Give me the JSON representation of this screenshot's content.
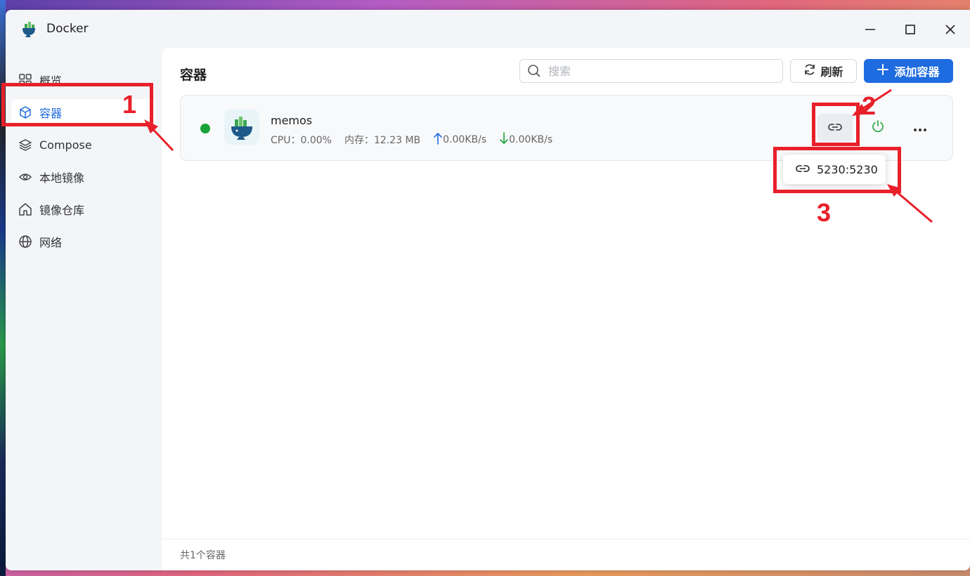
{
  "window": {
    "title": "Docker"
  },
  "sidebar": {
    "items": [
      {
        "label": "概览",
        "icon": "grid-icon"
      },
      {
        "label": "容器",
        "icon": "cube-icon",
        "active": true
      },
      {
        "label": "Compose",
        "icon": "layers-icon"
      },
      {
        "label": "本地镜像",
        "icon": "eye-icon"
      },
      {
        "label": "镜像仓库",
        "icon": "home-icon"
      },
      {
        "label": "网络",
        "icon": "globe-icon"
      }
    ]
  },
  "main": {
    "title": "容器",
    "search_placeholder": "搜索",
    "refresh_label": "刷新",
    "add_label": "添加容器",
    "footer": "共1个容器"
  },
  "container": {
    "name": "memos",
    "status_color": "#1aa33a",
    "cpu": "CPU：0.00%",
    "memory": "内存：12.23 MB",
    "upload": "0.00KB/s",
    "download": "0.00KB/s",
    "port_mapping": "5230:5230"
  },
  "annotations": {
    "n1": "1",
    "n2": "2",
    "n3": "3",
    "color": "#e8202a"
  },
  "colors": {
    "accent": "#1f6be0"
  }
}
